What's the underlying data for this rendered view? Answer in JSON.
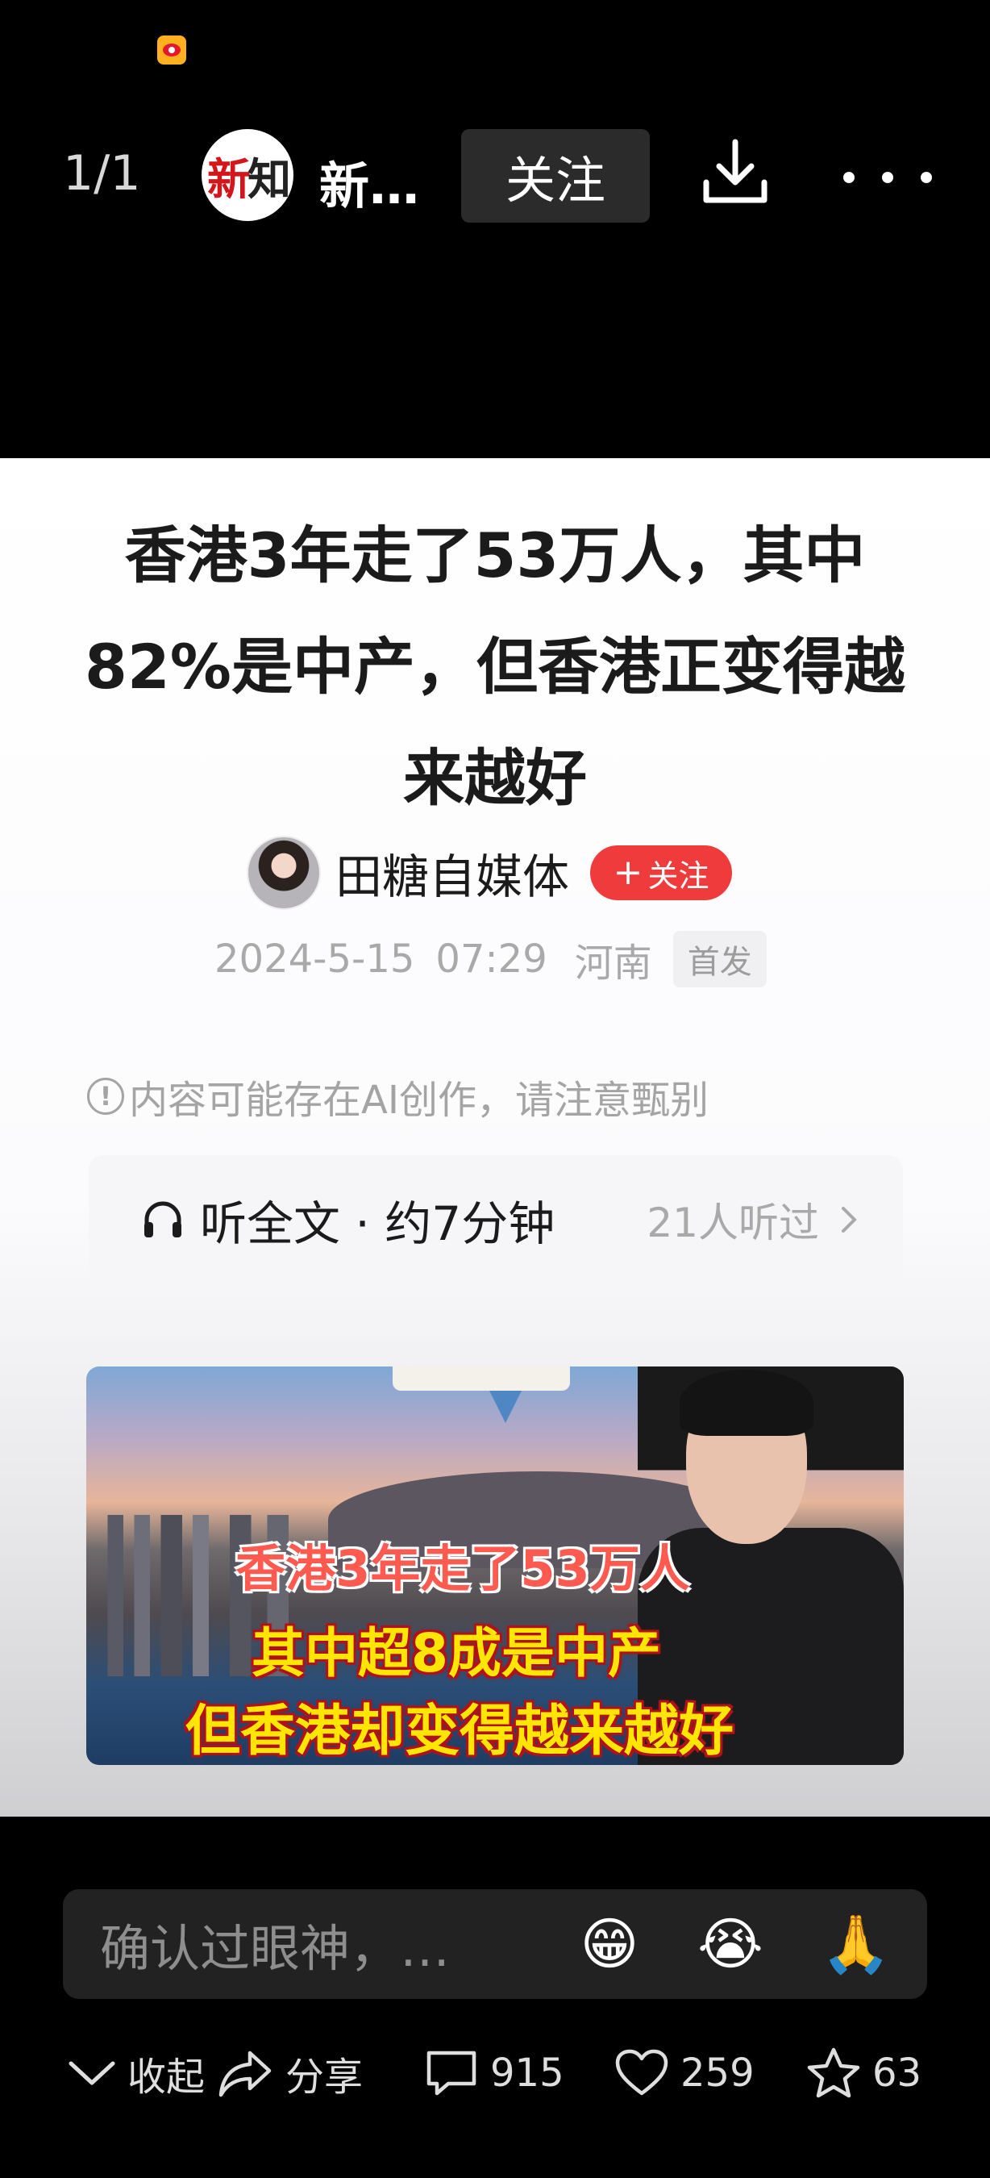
{
  "topbar": {
    "counter": "1/1",
    "account_name": "新…",
    "logo_text_red": "新",
    "logo_text_dark": "知",
    "follow_label": "关注"
  },
  "article": {
    "title": "香港3年走了53万人，其中82%是中产，但香港正变得越来越好",
    "author": "田糖自媒体",
    "follow_author_label": "关注",
    "date": "2024-5-15",
    "time": "07:29",
    "location": "河南",
    "badge": "首发",
    "ai_notice": "内容可能存在AI创作，请注意甄别",
    "listen_label": "听全文 · 约7分钟",
    "listen_count": "21人听过",
    "cover": {
      "caption_line1": "香港3年走了53万人",
      "caption_line2": "其中超8成是中产",
      "caption_line3": "但香港却变得越来越好"
    }
  },
  "bottombar": {
    "comment_placeholder": "确认过眼神，…",
    "emojis": [
      "😁",
      "😭",
      "🙏"
    ],
    "collapse_label": "收起",
    "share_label": "分享",
    "comment_count": "915",
    "like_count": "259",
    "favorite_count": "63"
  },
  "colors": {
    "follow_red": "#ef3b3b",
    "background": "#000000",
    "card": "#ffffff"
  }
}
